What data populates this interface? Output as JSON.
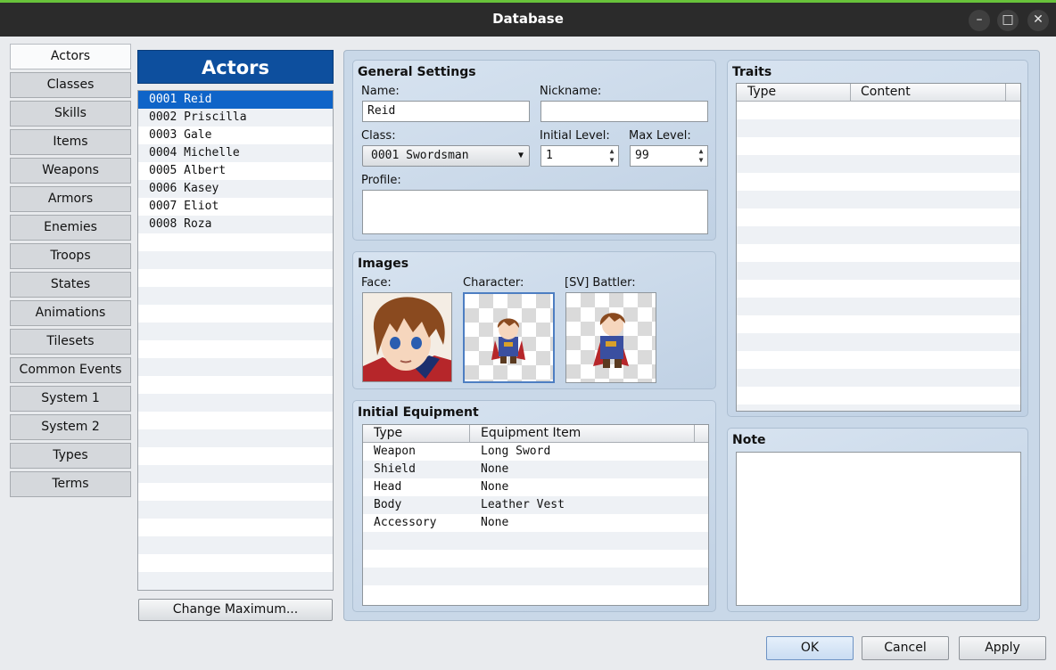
{
  "window": {
    "title": "Database",
    "controls": [
      "–",
      "□",
      "✕"
    ]
  },
  "nav": {
    "items": [
      "Actors",
      "Classes",
      "Skills",
      "Items",
      "Weapons",
      "Armors",
      "Enemies",
      "Troops",
      "States",
      "Animations",
      "Tilesets",
      "Common Events",
      "System 1",
      "System 2",
      "Types",
      "Terms"
    ],
    "active": "Actors"
  },
  "actors": {
    "header": "Actors",
    "list": [
      "0001 Reid",
      "0002 Priscilla",
      "0003 Gale",
      "0004 Michelle",
      "0005 Albert",
      "0006 Kasey",
      "0007 Eliot",
      "0008 Roza"
    ],
    "selected": "0001 Reid",
    "change_max_label": "Change Maximum..."
  },
  "general": {
    "title": "General Settings",
    "name_label": "Name:",
    "name_value": "Reid",
    "nickname_label": "Nickname:",
    "nickname_value": "",
    "class_label": "Class:",
    "class_value": "0001 Swordsman",
    "initial_level_label": "Initial Level:",
    "initial_level_value": "1",
    "max_level_label": "Max Level:",
    "max_level_value": "99",
    "profile_label": "Profile:",
    "profile_value": ""
  },
  "images": {
    "title": "Images",
    "face_label": "Face:",
    "character_label": "Character:",
    "battler_label": "[SV] Battler:"
  },
  "equipment": {
    "title": "Initial Equipment",
    "col_type": "Type",
    "col_item": "Equipment Item",
    "rows": [
      {
        "type": "Weapon",
        "item": "Long Sword"
      },
      {
        "type": "Shield",
        "item": "None"
      },
      {
        "type": "Head",
        "item": "None"
      },
      {
        "type": "Body",
        "item": "Leather Vest"
      },
      {
        "type": "Accessory",
        "item": "None"
      }
    ]
  },
  "traits": {
    "title": "Traits",
    "col_type": "Type",
    "col_content": "Content"
  },
  "note": {
    "title": "Note",
    "value": ""
  },
  "footer": {
    "ok": "OK",
    "cancel": "Cancel",
    "apply": "Apply"
  },
  "colors": {
    "accent": "#0d4f9e",
    "selection": "#0f64c8",
    "titlebar": "#2b2b2b",
    "panel": "#c9d8e8"
  }
}
